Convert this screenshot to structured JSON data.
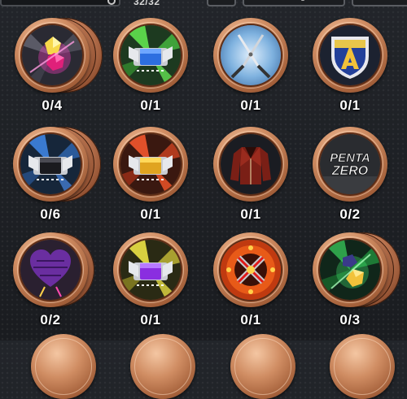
{
  "topbar": {
    "count": "32/32"
  },
  "rows": [
    [
      {
        "count": "0/4",
        "icon": "pink-gem-cube-icon"
      },
      {
        "count": "0/1",
        "icon": "blue-ticket-card-icon"
      },
      {
        "count": "0/1",
        "icon": "scissors-icon"
      },
      {
        "count": "0/1",
        "icon": "shield-emblem-icon"
      }
    ],
    [
      {
        "count": "0/6",
        "icon": "black-ticket-card-icon"
      },
      {
        "count": "0/1",
        "icon": "gold-ticket-card-icon"
      },
      {
        "count": "0/1",
        "icon": "leather-jacket-icon"
      },
      {
        "count": "0/2",
        "icon": "penta-zero-logo-icon",
        "logo_text": [
          "PENTA",
          "ZERO"
        ]
      }
    ],
    [
      {
        "count": "0/2",
        "icon": "purple-heart-icon"
      },
      {
        "count": "0/1",
        "icon": "purple-ticket-card-icon"
      },
      {
        "count": "0/1",
        "icon": "red-cross-emblem-icon"
      },
      {
        "count": "0/3",
        "icon": "green-gem-cube-icon"
      }
    ]
  ],
  "colors": {
    "bronze": "#c07a55",
    "background": "#1c1e22",
    "count_text": "#ffffff"
  }
}
